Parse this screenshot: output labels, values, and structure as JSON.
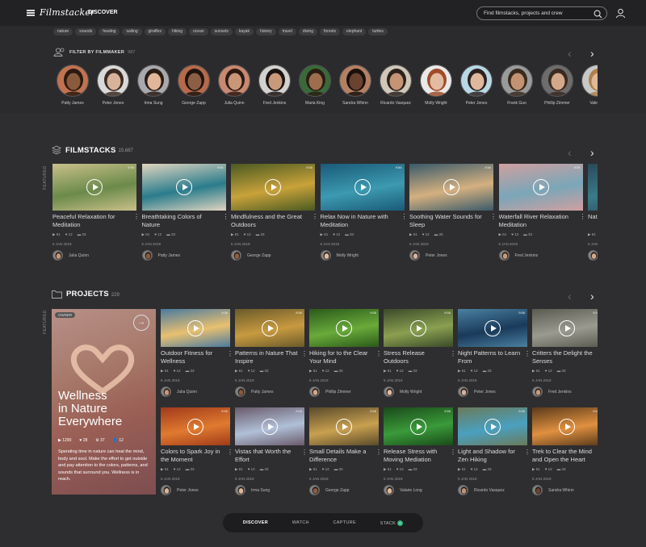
{
  "header": {
    "logo": "Filmstacker",
    "nav_discover": "DISCOVER",
    "search_placeholder": "Find filmstacks, projects and crew"
  },
  "tags": [
    "nature",
    "sounds",
    "healing",
    "sailing",
    "giraffes",
    "hiking",
    "ocean",
    "sunsets",
    "kayak",
    "history",
    "travel",
    "diving",
    "forests",
    "elephant",
    "turtles"
  ],
  "filmmakers": {
    "title": "FILTER BY FILMMAKER",
    "count": "987",
    "people": [
      {
        "name": "Patty James",
        "skin": "#8a5a3c",
        "hair": "#2a1a12",
        "bg": "#c27250"
      },
      {
        "name": "Peter Jones",
        "skin": "#d8b39a",
        "hair": "#3b2b22",
        "bg": "#d9d9d9"
      },
      {
        "name": "Irma Sung",
        "skin": "#e1b69a",
        "hair": "#2a1c16",
        "bg": "#a8a8ad"
      },
      {
        "name": "George Zapp",
        "skin": "#8c5e44",
        "hair": "#1e1410",
        "bg": "#b66a4a"
      },
      {
        "name": "Julia Quinn",
        "skin": "#c99678",
        "hair": "#2a1a14",
        "bg": "#c98870"
      },
      {
        "name": "Fred Jenkins",
        "skin": "#c99a7a",
        "hair": "#1a1412",
        "bg": "#d4d2cf"
      },
      {
        "name": "Maria King",
        "skin": "#9c6e4e",
        "hair": "#2a1d14",
        "bg": "#3a6a3a"
      },
      {
        "name": "Sandra Whinn",
        "skin": "#6a4230",
        "hair": "#1a100c",
        "bg": "#b38063"
      },
      {
        "name": "Ricardo Vasquez",
        "skin": "#c49474",
        "hair": "#2b221c",
        "bg": "#cfc7b8"
      },
      {
        "name": "Molly Wright",
        "skin": "#e3bba2",
        "hair": "#a04c28",
        "bg": "#e9e9e9"
      },
      {
        "name": "Peter Jones",
        "skin": "#e0b89e",
        "hair": "#2b2220",
        "bg": "#b9d8e6"
      },
      {
        "name": "Frank Guo",
        "skin": "#c29272",
        "hair": "#3a2a1e",
        "bg": "#9a9a9a"
      },
      {
        "name": "Phillip Zimmer",
        "skin": "#d4a88a",
        "hair": "#3a2a20",
        "bg": "#6d6d6d"
      },
      {
        "name": "Valerie L",
        "skin": "#e0b898",
        "hair": "#b08048",
        "bg": "#c8c8c8"
      }
    ]
  },
  "filmstacks": {
    "title": "FILMSTACKS",
    "count": "15,687",
    "featured": "FEATURED",
    "cards": [
      {
        "title": "Peaceful Relaxation for Meditation",
        "dur": "9:56",
        "views": "61",
        "likes": "12",
        "comments": "33",
        "date": "5 JAN 2019",
        "owner": "Julia Quinn",
        "c1": "#6b8a4a",
        "c2": "#c9c08a",
        "oc": "#c99678"
      },
      {
        "title": "Breathtaking Colors of Nature",
        "dur": "9:56",
        "views": "61",
        "likes": "12",
        "comments": "33",
        "date": "5 JAN 2019",
        "owner": "Patty James",
        "c1": "#2a7c8c",
        "c2": "#e0d5c0",
        "oc": "#8a5a3c"
      },
      {
        "title": "Mindfulness and the Great Outdoors",
        "dur": "9:56",
        "views": "61",
        "likes": "12",
        "comments": "33",
        "date": "5 JAN 2019",
        "owner": "George Zapp",
        "c1": "#c9a23a",
        "c2": "#4a5a22",
        "oc": "#8c5e44"
      },
      {
        "title": "Relax Now in Nature with Meditation",
        "dur": "9:56",
        "views": "61",
        "likes": "12",
        "comments": "33",
        "date": "5 JAN 2019",
        "owner": "Molly Wright",
        "c1": "#3c9ab0",
        "c2": "#1a5a78",
        "oc": "#e3bba2"
      },
      {
        "title": "Soothing Water Sounds for Sleep",
        "dur": "9:56",
        "views": "61",
        "likes": "12",
        "comments": "33",
        "date": "5 JAN 2019",
        "owner": "Peter Jones",
        "c1": "#d4b080",
        "c2": "#3a5a6a",
        "oc": "#d8b39a"
      },
      {
        "title": "Waterfall River Relaxation Meditation",
        "dur": "9:56",
        "views": "61",
        "likes": "12",
        "comments": "33",
        "date": "5 JAN 2019",
        "owner": "Fred Jenkins",
        "c1": "#7aa6b8",
        "c2": "#d0a0a0",
        "oc": "#c99a7a"
      },
      {
        "title": "Nat Sin",
        "dur": "9:56",
        "views": "61",
        "likes": "12",
        "comments": "33",
        "date": "5 JAN 2019",
        "owner": "",
        "c1": "#3a7a8a",
        "c2": "#2a4a5a",
        "oc": "#d4a88a"
      }
    ]
  },
  "projects": {
    "title": "PROJECTS",
    "count": "229",
    "featured": "FEATURED",
    "big": {
      "badge": "OWNER",
      "title_lines": [
        "Wellness",
        "in Nature",
        "Everywhere"
      ],
      "stat_views": "1290",
      "stat_likes": "28",
      "stat_stacks": "37",
      "stat_people": "12",
      "desc": "Spending time in nature can heal the mind, body and soul. Make the effort to get outside and pay attention to the colors, patterns, and sounds that surround you. Wellness is in reach."
    },
    "row1": [
      {
        "title": "Outdoor Fitness for Wellness",
        "dur": "9:56",
        "views": "61",
        "likes": "12",
        "comments": "33",
        "date": "5 JAN 2019",
        "owner": "Julia Quinn",
        "c1": "#e8c070",
        "c2": "#4a7aa0",
        "oc": "#c99678"
      },
      {
        "title": "Patterns in Nature That Inspire",
        "dur": "9:56",
        "views": "61",
        "likes": "12",
        "comments": "33",
        "date": "5 JAN 2019",
        "owner": "Patty James",
        "c1": "#c89a40",
        "c2": "#6a5a2a",
        "oc": "#8a5a3c"
      },
      {
        "title": "Hiking for to the Clear Your Mind",
        "dur": "9:56",
        "views": "61",
        "likes": "12",
        "comments": "33",
        "date": "5 JAN 2019",
        "owner": "Phillip Zimmer",
        "c1": "#6aaa3a",
        "c2": "#2a5a1a",
        "oc": "#d4a88a"
      },
      {
        "title": "Stress Release Outdoors",
        "dur": "9:56",
        "views": "61",
        "likes": "12",
        "comments": "33",
        "date": "5 JAN 2019",
        "owner": "Molly Wright",
        "c1": "#8aa050",
        "c2": "#3a4a2a",
        "oc": "#e3bba2"
      },
      {
        "title": "Night Patterns to Learn From",
        "dur": "9:56",
        "views": "61",
        "likes": "12",
        "comments": "33",
        "date": "5 JAN 2019",
        "owner": "Peter Jones",
        "c1": "#1a3a5a",
        "c2": "#4a80a0",
        "oc": "#d8b39a"
      },
      {
        "title": "Critters the Delight the Senses",
        "dur": "9:56",
        "views": "61",
        "likes": "12",
        "comments": "33",
        "date": "5 JAN 2019",
        "owner": "Fred Jenkins",
        "c1": "#9a9a90",
        "c2": "#5a5a50",
        "oc": "#c99a7a"
      }
    ],
    "row2": [
      {
        "title": "Colors to Spark Joy in the Moment",
        "dur": "9:56",
        "views": "61",
        "likes": "12",
        "comments": "33",
        "date": "5 JAN 2019",
        "owner": "Peter Jones",
        "c1": "#e07a30",
        "c2": "#a03a1a",
        "oc": "#d8b39a"
      },
      {
        "title": "Vistas that Worth the Effort",
        "dur": "9:56",
        "views": "61",
        "likes": "12",
        "comments": "33",
        "date": "5 JAN 2019",
        "owner": "Irma Sung",
        "c1": "#b0c0d8",
        "c2": "#6a5a6a",
        "oc": "#e1b69a"
      },
      {
        "title": "Small Details Make a Difference",
        "dur": "9:56",
        "views": "61",
        "likes": "12",
        "comments": "33",
        "date": "5 JAN 2019",
        "owner": "George Zapp",
        "c1": "#c8a050",
        "c2": "#5a4a2a",
        "oc": "#8c5e44"
      },
      {
        "title": "Release Stress with Moving Mediation",
        "dur": "9:56",
        "views": "61",
        "likes": "12",
        "comments": "33",
        "date": "5 JAN 2019",
        "owner": "Valarie Long",
        "c1": "#3a9a3a",
        "c2": "#1a4a1a",
        "oc": "#e0b898"
      },
      {
        "title": "Light and Shadow for Zen Hiking",
        "dur": "9:56",
        "views": "61",
        "likes": "12",
        "comments": "33",
        "date": "5 JAN 2019",
        "owner": "Ricardo Vasquez",
        "c1": "#4aa0c0",
        "c2": "#6a7a5a",
        "oc": "#c49474"
      },
      {
        "title": "Trek to Clear the Mind and Open the Heart",
        "dur": "9:56",
        "views": "61",
        "likes": "12",
        "comments": "33",
        "date": "5 JAN 2019",
        "owner": "Sandra Whinn",
        "c1": "#e09040",
        "c2": "#5a3a1a",
        "oc": "#6a4230"
      }
    ]
  },
  "bottom_nav": {
    "discover": "DISCOVER",
    "watch": "WATCH",
    "capture": "CAPTURE",
    "stack": "STACK",
    "stack_badge": "0"
  }
}
